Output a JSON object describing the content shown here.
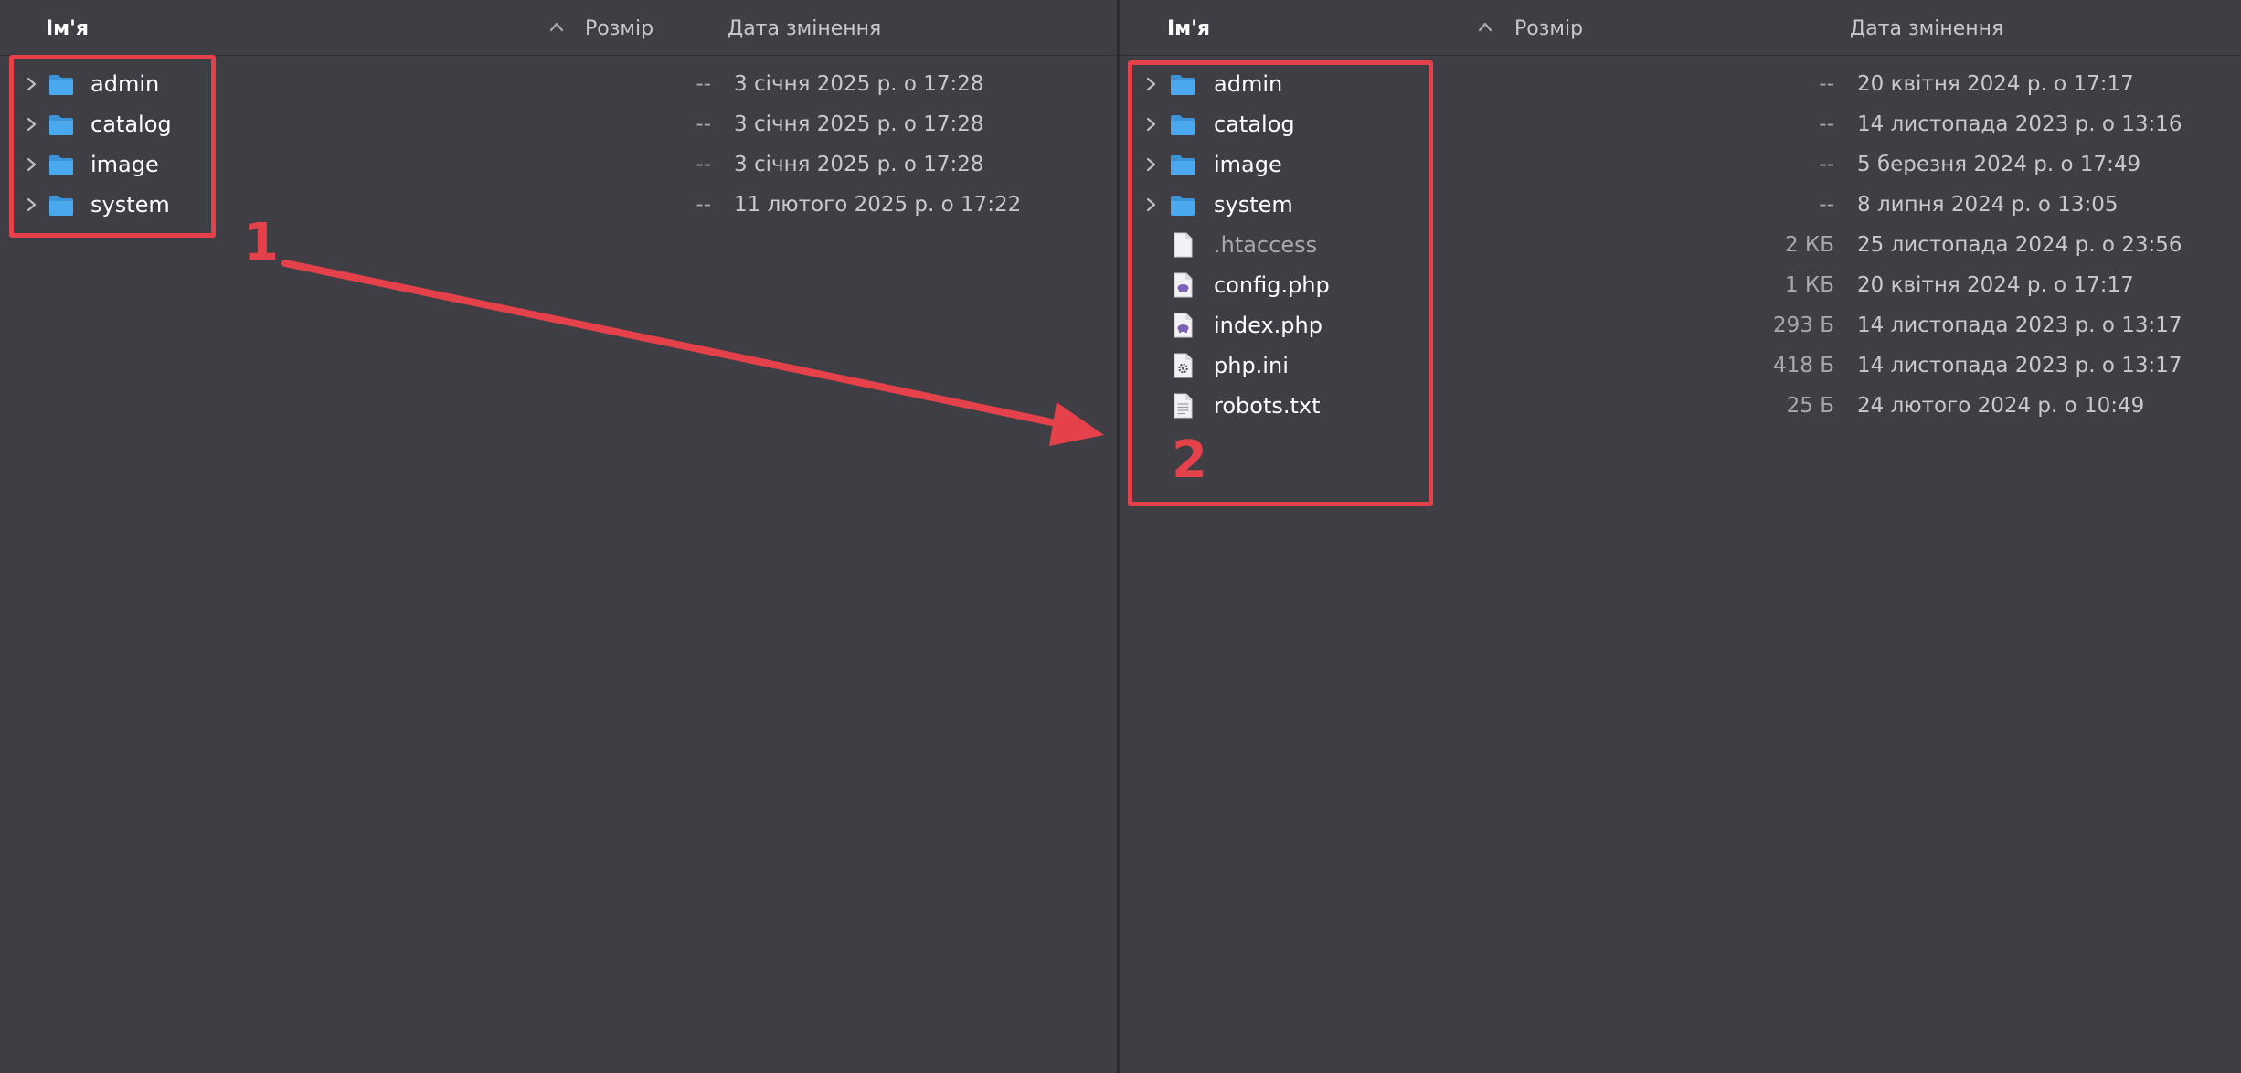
{
  "colors": {
    "background": "#3f3e45",
    "annotation": "#e5414a",
    "folder": "#4aa8ee"
  },
  "left_pane": {
    "headers": {
      "name": "Ім'я",
      "size": "Розмір",
      "date": "Дата змінення"
    },
    "rows": [
      {
        "name": "admin",
        "kind": "folder",
        "size": "--",
        "date": "3 січня 2025 р. о 17:28"
      },
      {
        "name": "catalog",
        "kind": "folder",
        "size": "--",
        "date": "3 січня 2025 р. о 17:28"
      },
      {
        "name": "image",
        "kind": "folder",
        "size": "--",
        "date": "3 січня 2025 р. о 17:28"
      },
      {
        "name": "system",
        "kind": "folder",
        "size": "--",
        "date": "11 лютого 2025 р. о 17:22"
      }
    ]
  },
  "right_pane": {
    "headers": {
      "name": "Ім'я",
      "size": "Розмір",
      "date": "Дата змінення"
    },
    "rows": [
      {
        "name": "admin",
        "kind": "folder",
        "size": "--",
        "date": "20 квітня 2024 р. о 17:17"
      },
      {
        "name": "catalog",
        "kind": "folder",
        "size": "--",
        "date": "14 листопада 2023 р. о 13:16"
      },
      {
        "name": "image",
        "kind": "folder",
        "size": "--",
        "date": "5 березня 2024 р. о 17:49"
      },
      {
        "name": "system",
        "kind": "folder",
        "size": "--",
        "date": "8 липня 2024 р. о 13:05"
      },
      {
        "name": ".htaccess",
        "kind": "hidden-file",
        "size": "2 КБ",
        "date": "25 листопада 2024 р. о 23:56"
      },
      {
        "name": "config.php",
        "kind": "php-file",
        "size": "1 КБ",
        "date": "20 квітня 2024 р. о 17:17"
      },
      {
        "name": "index.php",
        "kind": "php-file",
        "size": "293 Б",
        "date": "14 листопада 2023 р. о 13:17"
      },
      {
        "name": "php.ini",
        "kind": "ini-file",
        "size": "418 Б",
        "date": "14 листопада 2023 р. о 13:17"
      },
      {
        "name": "robots.txt",
        "kind": "text-file",
        "size": "25 Б",
        "date": "24 лютого 2024 р. о 10:49"
      }
    ]
  },
  "annotations": {
    "marker_1": "1",
    "marker_2": "2"
  },
  "icons": {
    "expand": "chevron-right-icon",
    "sort": "chevron-up-icon",
    "folder": "folder-icon",
    "hidden-file": "blank-file-icon",
    "php-file": "php-file-icon",
    "ini-file": "gear-file-icon",
    "text-file": "text-file-icon"
  }
}
